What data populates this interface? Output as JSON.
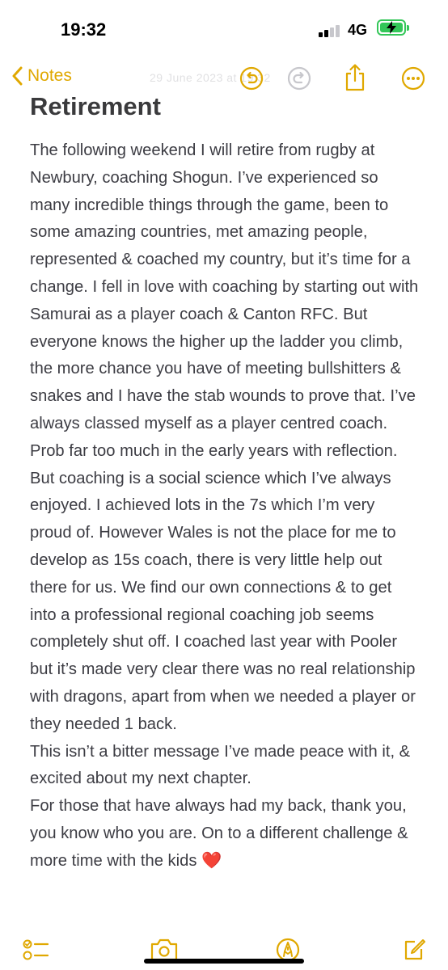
{
  "status_bar": {
    "time": "19:32",
    "network": "4G",
    "battery_icon": "battery-charging-icon",
    "accent_battery": "#34c759"
  },
  "nav": {
    "back_label": "Notes",
    "back_icon": "chevron-left-icon",
    "faded_date": "29 June 2023 at 19:32",
    "icons": [
      "undo-icon",
      "redo-icon",
      "share-icon",
      "more-icon"
    ],
    "accent_color": "#e0a800"
  },
  "note": {
    "title": "Retirement",
    "paragraphs": [
      "The following weekend I will retire from rugby at Newbury, coaching Shogun. I’ve experienced so many incredible things through the game, been to some amazing countries, met amazing people, represented & coached my country, but it’s time for a change. I fell in love with coaching by starting out with Samurai as a player coach & Canton RFC. But everyone knows the higher up the ladder you climb, the more chance you have of meeting bullshitters & snakes and I have the stab wounds to prove that. I’ve always classed myself as a player centred coach. Prob far too much in the early years with reflection. But coaching is a social science which I’ve always enjoyed. I achieved lots in the 7s which I’m very proud of. However Wales is not the place for me to develop as 15s coach, there is very little help out there for us. We find our own connections & to get into a professional regional coaching job seems completely shut off. I coached last year with Pooler but it’s made very clear there was no real relationship with dragons, apart from when we needed a player or they needed 1 back.",
      "This isn’t a bitter message I’ve made peace with it, & excited about my next chapter.",
      "For those that have always had my back, thank you, you know who you are. On to a different challenge & more time with the kids ❤️"
    ]
  },
  "toolbar": {
    "icons": [
      "checklist-icon",
      "camera-icon",
      "markup-pen-icon",
      "compose-icon"
    ]
  }
}
